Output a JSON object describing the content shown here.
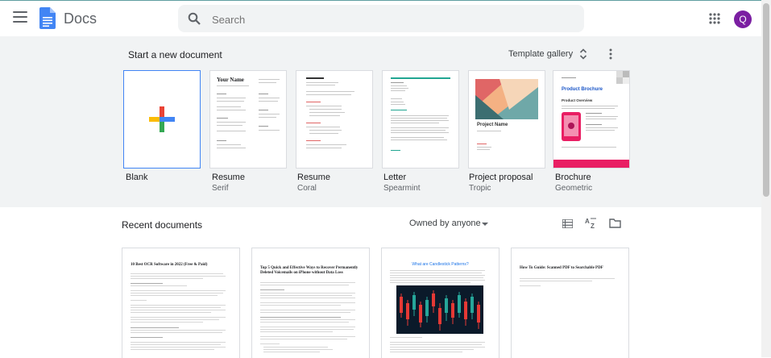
{
  "header": {
    "app_name": "Docs",
    "search_placeholder": "Search",
    "avatar_initial": "Q"
  },
  "start": {
    "title": "Start a new document",
    "gallery_label": "Template gallery",
    "templates": [
      {
        "name": "Blank",
        "sub": ""
      },
      {
        "name": "Resume",
        "sub": "Serif",
        "preview_title": "Your Name"
      },
      {
        "name": "Resume",
        "sub": "Coral"
      },
      {
        "name": "Letter",
        "sub": "Spearmint"
      },
      {
        "name": "Project proposal",
        "sub": "Tropic",
        "preview_title": "Project Name"
      },
      {
        "name": "Brochure",
        "sub": "Geometric",
        "preview_title": "Product Brochure",
        "preview_overview": "Product Overview"
      }
    ]
  },
  "recent": {
    "title": "Recent documents",
    "owner_filter": "Owned by anyone",
    "docs": [
      {
        "preview_title": "10 Best OCR Software in 2022 (Free & Paid)"
      },
      {
        "preview_title": "Top 5 Quick and Effective Ways to Recover Permanently Deleted Voicemails on iPhone without Data Loss"
      },
      {
        "preview_title": "What are Candlestick Patterns?"
      },
      {
        "preview_title": "How To Guide: Scanned PDF to Searchable PDF"
      }
    ]
  },
  "colors": {
    "accent_blue": "#4285f4",
    "avatar_bg": "#7b1fa2",
    "start_bg": "#f1f3f4",
    "coral": "#e06666",
    "teal": "#21a692",
    "brochure_pink": "#e91e63"
  },
  "icons": [
    "menu-icon",
    "docs-logo-icon",
    "search-icon",
    "apps-grid-icon",
    "unfold-icon",
    "more-vert-icon",
    "plus-icon",
    "list-view-icon",
    "sort-az-icon",
    "folder-icon",
    "dropdown-caret-icon"
  ]
}
